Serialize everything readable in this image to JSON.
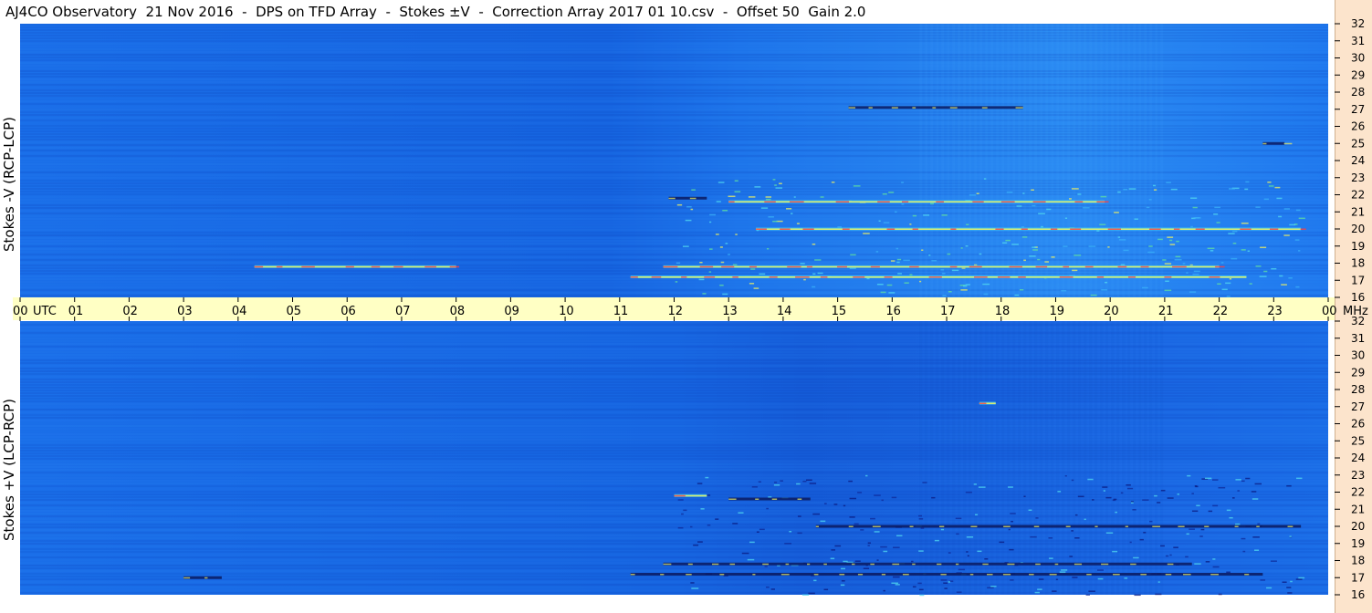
{
  "title": "AJ4CO Observatory  21 Nov 2016  -  DPS on TFD Array  -  Stokes ±V  -  Correction Array 2017 01 10.csv  -  Offset 50  Gain 2.0",
  "chart_data": [
    {
      "type": "heatmap",
      "panel": "top",
      "ylabel": "Stokes -V (RCP-LCP)",
      "x_unit": "UTC",
      "y_unit": "MHz",
      "xlim": [
        0,
        24
      ],
      "ylim": [
        16,
        32
      ],
      "x_ticks": [
        "00",
        "01",
        "02",
        "03",
        "04",
        "05",
        "06",
        "07",
        "08",
        "09",
        "10",
        "11",
        "12",
        "13",
        "14",
        "15",
        "16",
        "17",
        "18",
        "19",
        "20",
        "21",
        "22",
        "23",
        "00"
      ],
      "y_ticks": [
        "16",
        "17",
        "18",
        "19",
        "20",
        "21",
        "22",
        "23",
        "24",
        "25",
        "26",
        "27",
        "28",
        "29",
        "30",
        "31",
        "32"
      ],
      "colormap": [
        "#0a1a80",
        "#1560e0",
        "#2f8cf0",
        "#40c8f0",
        "#f0f060",
        "#ff4040"
      ],
      "features": [
        {
          "kind": "bright",
          "freq": 17.2,
          "start": 11.2,
          "end": 22.5
        },
        {
          "kind": "bright",
          "freq": 17.8,
          "start": 11.8,
          "end": 22.0
        },
        {
          "kind": "bright",
          "freq": 20.0,
          "start": 13.5,
          "end": 23.5
        },
        {
          "kind": "bright",
          "freq": 21.6,
          "start": 13.0,
          "end": 19.9
        },
        {
          "kind": "bright",
          "freq": 17.8,
          "start": 4.3,
          "end": 8.0
        },
        {
          "kind": "dark",
          "freq": 21.8,
          "start": 11.9,
          "end": 12.6
        },
        {
          "kind": "dark",
          "freq": 27.1,
          "start": 15.2,
          "end": 18.4
        },
        {
          "kind": "dark",
          "freq": 25.0,
          "start": 22.8,
          "end": 23.2
        }
      ]
    },
    {
      "type": "heatmap",
      "panel": "bottom",
      "ylabel": "Stokes +V (LCP-RCP)",
      "x_unit": "UTC",
      "y_unit": "MHz",
      "xlim": [
        0,
        24
      ],
      "ylim": [
        16,
        32
      ],
      "x_ticks": [
        "00",
        "01",
        "02",
        "03",
        "04",
        "05",
        "06",
        "07",
        "08",
        "09",
        "10",
        "11",
        "12",
        "13",
        "14",
        "15",
        "16",
        "17",
        "18",
        "19",
        "20",
        "21",
        "22",
        "23",
        "00"
      ],
      "y_ticks": [
        "16",
        "17",
        "18",
        "19",
        "20",
        "21",
        "22",
        "23",
        "24",
        "25",
        "26",
        "27",
        "28",
        "29",
        "30",
        "31",
        "32"
      ],
      "colormap": [
        "#0a1a80",
        "#1560e0",
        "#2f8cf0",
        "#40c8f0",
        "#f0f060",
        "#ff4040"
      ],
      "features": [
        {
          "kind": "dark",
          "freq": 17.2,
          "start": 11.2,
          "end": 22.8
        },
        {
          "kind": "dark",
          "freq": 17.8,
          "start": 11.8,
          "end": 21.5
        },
        {
          "kind": "dark",
          "freq": 20.0,
          "start": 14.6,
          "end": 23.5
        },
        {
          "kind": "dark",
          "freq": 21.6,
          "start": 13.0,
          "end": 14.5
        },
        {
          "kind": "dark",
          "freq": 17.0,
          "start": 3.0,
          "end": 3.7
        },
        {
          "kind": "bright",
          "freq": 21.8,
          "start": 12.0,
          "end": 12.6
        },
        {
          "kind": "bright",
          "freq": 27.2,
          "start": 17.6,
          "end": 17.9
        }
      ]
    }
  ]
}
